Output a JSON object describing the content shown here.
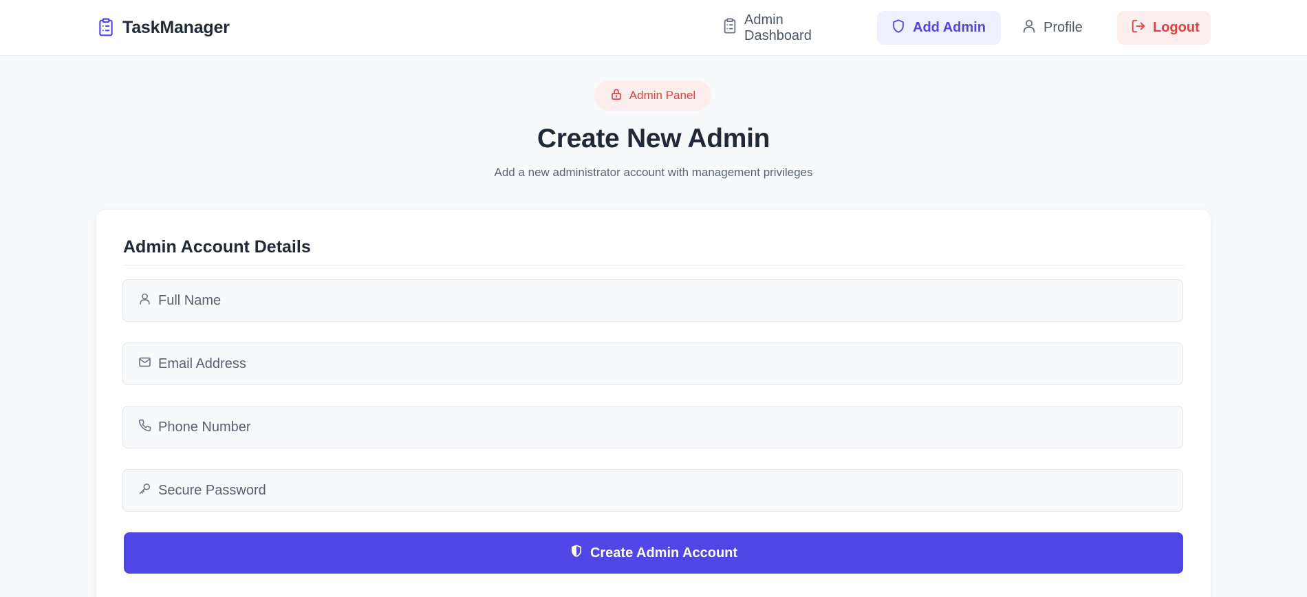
{
  "app": {
    "name": "TaskManager"
  },
  "nav": {
    "dashboard_label": "Admin Dashboard",
    "add_admin_label": "Add Admin",
    "profile_label": "Profile",
    "logout_label": "Logout",
    "active": "add_admin"
  },
  "header": {
    "badge": "Admin Panel",
    "title": "Create New Admin",
    "subtitle": "Add a new administrator account with management privileges"
  },
  "form": {
    "title": "Admin Account Details",
    "fields": [
      {
        "icon": "user-icon",
        "placeholder": "Full Name",
        "value": ""
      },
      {
        "icon": "mail-icon",
        "placeholder": "Email Address",
        "value": ""
      },
      {
        "icon": "phone-icon",
        "placeholder": "Phone Number",
        "value": ""
      },
      {
        "icon": "key-icon",
        "placeholder": "Secure Password",
        "value": ""
      }
    ],
    "submit_label": "Create Admin Account"
  },
  "colors": {
    "accent": "#4f46e5",
    "accent_soft": "#eef0fe",
    "danger": "#e53e3e",
    "danger_soft": "#fdeeee",
    "page_bg": "#f8f9fb"
  }
}
